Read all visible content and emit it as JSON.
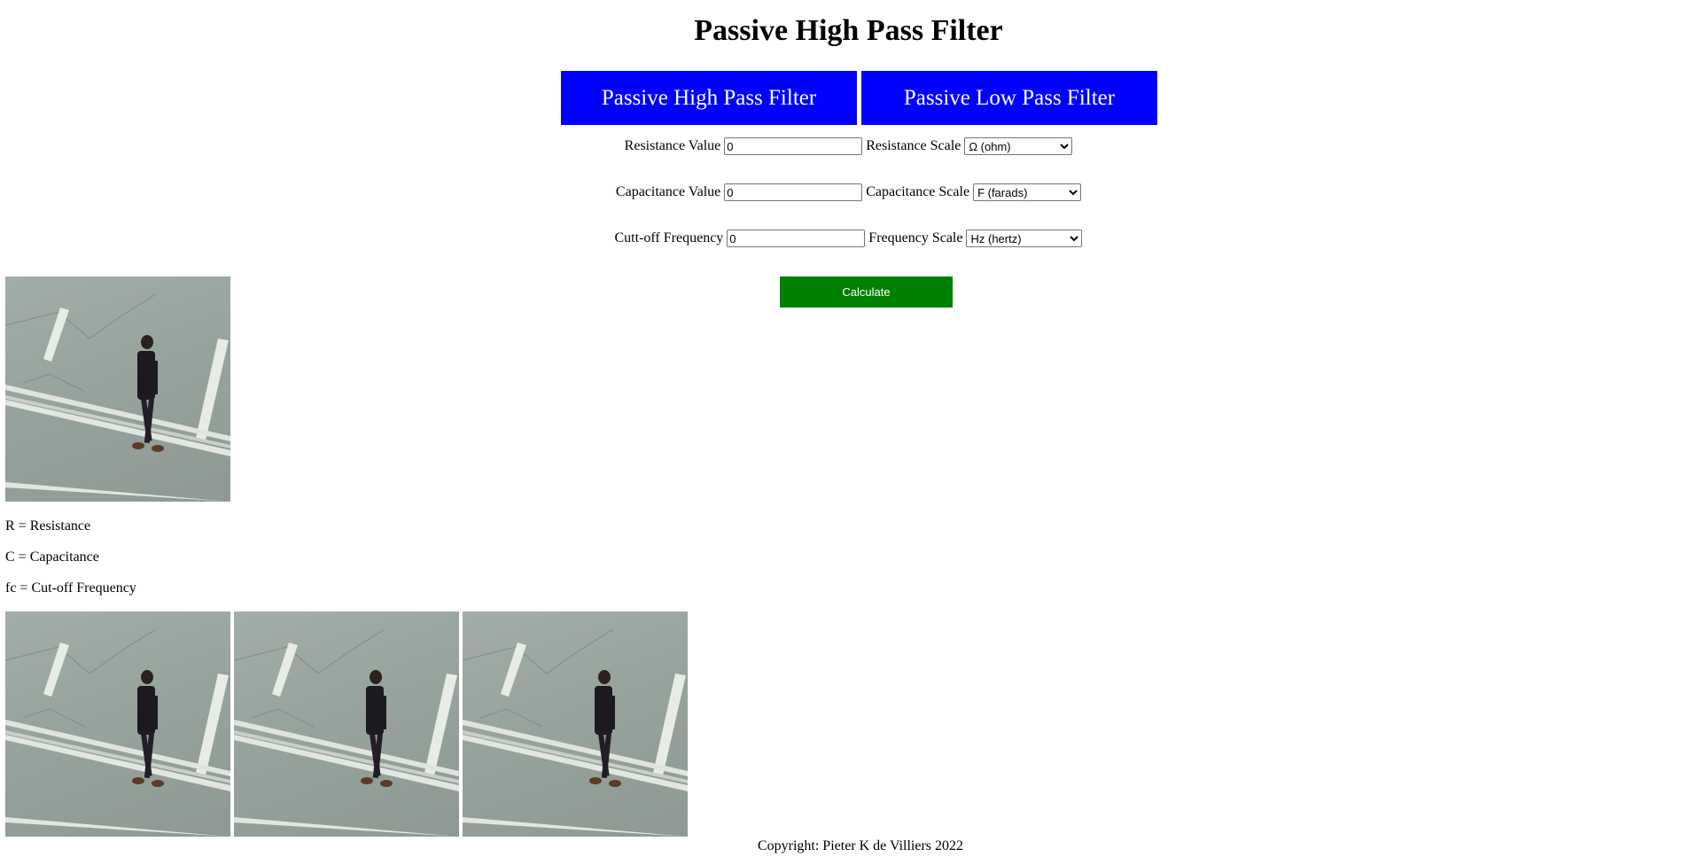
{
  "page": {
    "title": "Passive High Pass Filter"
  },
  "tabs": [
    {
      "label": "Passive High Pass Filter"
    },
    {
      "label": "Passive Low Pass Filter"
    }
  ],
  "form": {
    "resistance_label": "Resistance Value",
    "resistance_value": "0",
    "resistance_scale_label": "Resistance Scale",
    "resistance_scale_selected": "Ω (ohm)",
    "capacitance_label": "Capacitance Value",
    "capacitance_value": "0",
    "capacitance_scale_label": "Capacitance Scale",
    "capacitance_scale_selected": "F (farads)",
    "frequency_label": "Cutt-off Frequency",
    "frequency_value": "0",
    "frequency_scale_label": "Frequency Scale",
    "frequency_scale_selected": "Hz (hertz)",
    "calculate_label": "Calculate"
  },
  "legend": {
    "r": "R = Resistance",
    "c": "C = Capacitance",
    "fc": "fc = Cut-off Frequency"
  },
  "footer": {
    "copyright": "Copyright: Pieter K de Villiers 2022"
  },
  "colors": {
    "tab_bg": "#0000ff",
    "calculate_bg": "#008000"
  }
}
